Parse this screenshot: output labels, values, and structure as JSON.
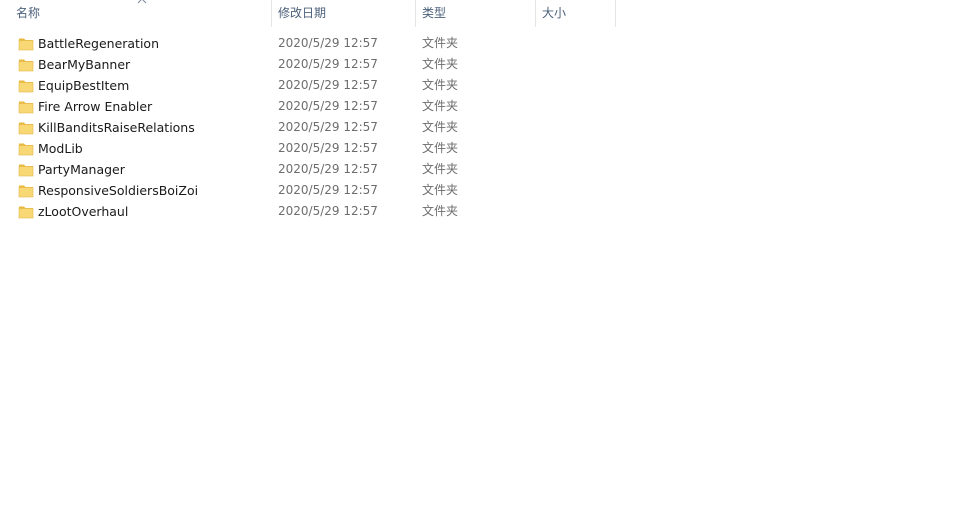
{
  "columns": {
    "name": "名称",
    "modified": "修改日期",
    "type": "类型",
    "size": "大小"
  },
  "sort": {
    "column": "name",
    "direction": "ascending",
    "icon": "chevron-up-icon"
  },
  "icons": {
    "folder": "folder-icon",
    "folder_color": "#f8d775",
    "folder_tab_color": "#e8b83c"
  },
  "colors": {
    "header_text": "#4c607a",
    "item_text": "#1a1a1a",
    "detail_text": "#6d6d6d",
    "separator": "#e5e5e5"
  },
  "items": [
    {
      "name": "BattleRegeneration",
      "modified": "2020/5/29 12:57",
      "type": "文件夹",
      "size": ""
    },
    {
      "name": "BearMyBanner",
      "modified": "2020/5/29 12:57",
      "type": "文件夹",
      "size": ""
    },
    {
      "name": "EquipBestItem",
      "modified": "2020/5/29 12:57",
      "type": "文件夹",
      "size": ""
    },
    {
      "name": "Fire Arrow Enabler",
      "modified": "2020/5/29 12:57",
      "type": "文件夹",
      "size": ""
    },
    {
      "name": "KillBanditsRaiseRelations",
      "modified": "2020/5/29 12:57",
      "type": "文件夹",
      "size": ""
    },
    {
      "name": "ModLib",
      "modified": "2020/5/29 12:57",
      "type": "文件夹",
      "size": ""
    },
    {
      "name": "PartyManager",
      "modified": "2020/5/29 12:57",
      "type": "文件夹",
      "size": ""
    },
    {
      "name": "ResponsiveSoldiersBoiZoi",
      "modified": "2020/5/29 12:57",
      "type": "文件夹",
      "size": ""
    },
    {
      "name": "zLootOverhaul",
      "modified": "2020/5/29 12:57",
      "type": "文件夹",
      "size": ""
    }
  ]
}
